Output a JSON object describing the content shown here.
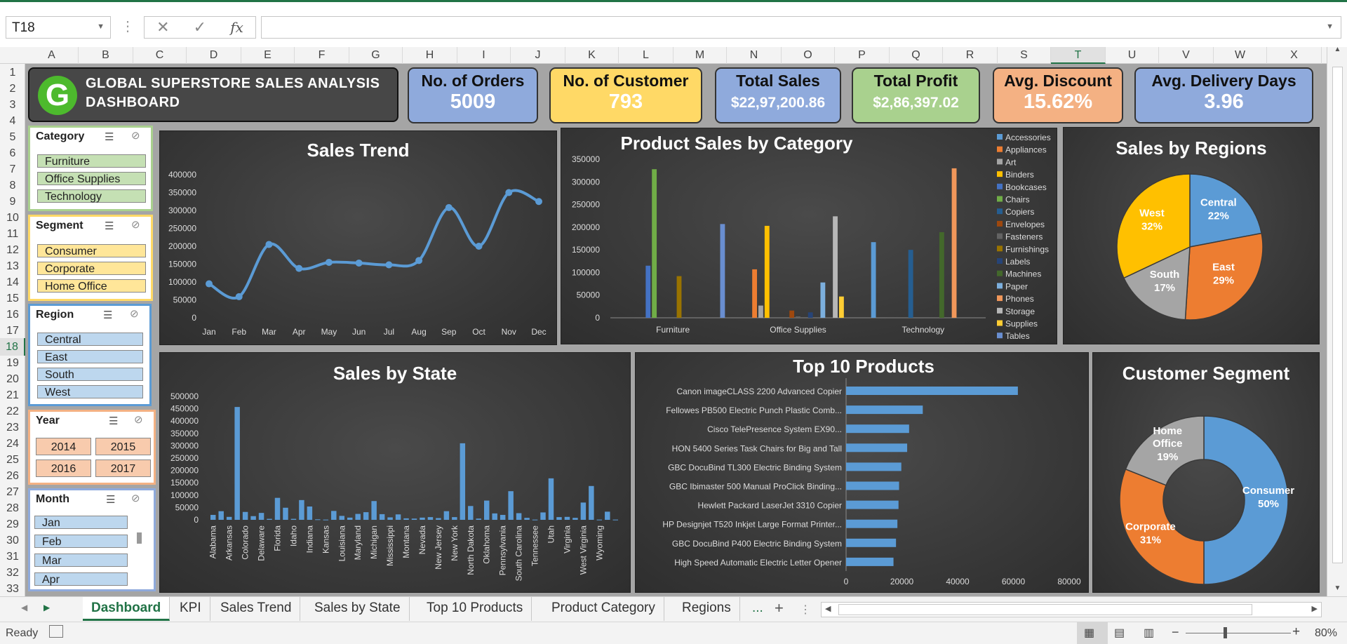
{
  "formula_bar": {
    "name_box": "T18",
    "fx_label": "fx",
    "formula": ""
  },
  "columns": [
    "A",
    "B",
    "C",
    "D",
    "E",
    "F",
    "G",
    "H",
    "I",
    "J",
    "K",
    "L",
    "M",
    "N",
    "O",
    "P",
    "Q",
    "R",
    "S",
    "T",
    "U",
    "V",
    "W",
    "X"
  ],
  "selected_column": "T",
  "rows": [
    "1",
    "2",
    "3",
    "4",
    "5",
    "6",
    "7",
    "8",
    "9",
    "10",
    "11",
    "12",
    "13",
    "14",
    "15",
    "16",
    "17",
    "18",
    "19",
    "20",
    "21",
    "22",
    "23",
    "24",
    "25",
    "26",
    "27",
    "28",
    "29",
    "30",
    "31",
    "32",
    "33"
  ],
  "selected_row": "18",
  "title": {
    "line1": "GLOBAL SUPERSTORE SALES ANALYSIS",
    "line2": "DASHBOARD",
    "logo_letter": "G"
  },
  "kpis": [
    {
      "label": "No. of Orders",
      "value": "5009",
      "bg": "#8faadc"
    },
    {
      "label": "No. of Customer",
      "value": "793",
      "bg": "#ffd966"
    },
    {
      "label": "Total Sales",
      "value": "$22,97,200.86",
      "bg": "#8faadc"
    },
    {
      "label": "Total Profit",
      "value": "$2,86,397.02",
      "bg": "#a9d18e"
    },
    {
      "label": "Avg. Discount",
      "value": "15.62%",
      "bg": "#f4b183"
    },
    {
      "label": "Avg. Delivery Days",
      "value": "3.96",
      "bg": "#8faadc"
    }
  ],
  "slicers": {
    "category": {
      "title": "Category",
      "items": [
        "Furniture",
        "Office Supplies",
        "Technology"
      ],
      "color": "#c5e0b4",
      "border": "#a9d18e"
    },
    "segment": {
      "title": "Segment",
      "items": [
        "Consumer",
        "Corporate",
        "Home Office"
      ],
      "color": "#ffe699",
      "border": "#ffd966"
    },
    "region": {
      "title": "Region",
      "items": [
        "Central",
        "East",
        "South",
        "West"
      ],
      "color": "#bdd7ee",
      "border": "#5b9bd5"
    },
    "year": {
      "title": "Year",
      "items": [
        "2014",
        "2015",
        "2016",
        "2017"
      ],
      "color": "#f8cbad",
      "border": "#f4b183"
    },
    "month": {
      "title": "Month",
      "items": [
        "Jan",
        "Feb",
        "Mar",
        "Apr"
      ],
      "color": "#bdd7ee",
      "border": "#8faadc"
    }
  },
  "chart_data": [
    {
      "type": "line",
      "title": "Sales Trend",
      "categories": [
        "Jan",
        "Feb",
        "Mar",
        "Apr",
        "May",
        "Jun",
        "Jul",
        "Aug",
        "Sep",
        "Oct",
        "Nov",
        "Dec"
      ],
      "values": [
        95000,
        59000,
        205000,
        138000,
        155000,
        153000,
        148000,
        160000,
        308000,
        200000,
        350000,
        325000
      ],
      "ylim": [
        0,
        400000
      ],
      "yticks": [
        "400000",
        "350000",
        "300000",
        "250000",
        "200000",
        "150000",
        "100000",
        "50000",
        "0"
      ],
      "color": "#5b9bd5"
    },
    {
      "type": "bar",
      "title": "Product Sales by Category",
      "categories": [
        "Furniture",
        "Office Supplies",
        "Technology"
      ],
      "ylim": [
        0,
        350000
      ],
      "yticks": [
        "350000",
        "300000",
        "250000",
        "200000",
        "150000",
        "100000",
        "50000",
        "0"
      ],
      "legend_position": "right",
      "series": [
        {
          "name": "Accessories",
          "color": "#5b9bd5",
          "values": [
            0,
            0,
            167000
          ]
        },
        {
          "name": "Appliances",
          "color": "#ed7d31",
          "values": [
            0,
            107000,
            0
          ]
        },
        {
          "name": "Art",
          "color": "#a5a5a5",
          "values": [
            0,
            27000,
            0
          ]
        },
        {
          "name": "Binders",
          "color": "#ffc000",
          "values": [
            0,
            203000,
            0
          ]
        },
        {
          "name": "Bookcases",
          "color": "#4472c4",
          "values": [
            115000,
            0,
            0
          ]
        },
        {
          "name": "Chairs",
          "color": "#70ad47",
          "values": [
            328000,
            0,
            0
          ]
        },
        {
          "name": "Copiers",
          "color": "#255e91",
          "values": [
            0,
            0,
            150000
          ]
        },
        {
          "name": "Envelopes",
          "color": "#9e480e",
          "values": [
            0,
            16000,
            0
          ]
        },
        {
          "name": "Fasteners",
          "color": "#636363",
          "values": [
            0,
            3000,
            0
          ]
        },
        {
          "name": "Furnishings",
          "color": "#997300",
          "values": [
            92000,
            0,
            0
          ]
        },
        {
          "name": "Labels",
          "color": "#264478",
          "values": [
            0,
            12000,
            0
          ]
        },
        {
          "name": "Machines",
          "color": "#43682b",
          "values": [
            0,
            0,
            189000
          ]
        },
        {
          "name": "Paper",
          "color": "#7cafdd",
          "values": [
            0,
            78000,
            0
          ]
        },
        {
          "name": "Phones",
          "color": "#f1975a",
          "values": [
            0,
            0,
            330000
          ]
        },
        {
          "name": "Storage",
          "color": "#b7b7b7",
          "values": [
            0,
            224000,
            0
          ]
        },
        {
          "name": "Supplies",
          "color": "#ffcd33",
          "values": [
            0,
            47000,
            0
          ]
        },
        {
          "name": "Tables",
          "color": "#698ed0",
          "values": [
            207000,
            0,
            0
          ]
        }
      ]
    },
    {
      "type": "pie",
      "title": "Sales by Regions",
      "slices": [
        {
          "label": "Central",
          "pct": "22%",
          "value": 22,
          "color": "#5b9bd5"
        },
        {
          "label": "East",
          "pct": "29%",
          "value": 29,
          "color": "#ed7d31"
        },
        {
          "label": "South",
          "pct": "17%",
          "value": 17,
          "color": "#a5a5a5"
        },
        {
          "label": "West",
          "pct": "32%",
          "value": 32,
          "color": "#ffc000"
        }
      ]
    },
    {
      "type": "bar",
      "title": "Sales by State",
      "ylim": [
        0,
        500000
      ],
      "yticks": [
        "500000",
        "450000",
        "400000",
        "350000",
        "300000",
        "250000",
        "200000",
        "150000",
        "100000",
        "50000",
        "0"
      ],
      "tick_labels": [
        "Alabama",
        "Arkansas",
        "Colorado",
        "Delaware",
        "Florida",
        "Idaho",
        "Indiana",
        "Kansas",
        "Louisiana",
        "Maryland",
        "Michigan",
        "Mississippi",
        "Montana",
        "Nevada",
        "New Jersey",
        "New York",
        "North Dakota",
        "Oklahoma",
        "Pennsylvania",
        "South Carolina",
        "Tennessee",
        "Utah",
        "Virginia",
        "West Virginia",
        "Wyoming"
      ],
      "values": [
        20000,
        35000,
        12000,
        457000,
        32000,
        15000,
        28000,
        4000,
        89000,
        49000,
        4000,
        80000,
        54000,
        2000,
        1000,
        36000,
        16000,
        9000,
        24000,
        31000,
        76000,
        23000,
        10000,
        22000,
        6000,
        5000,
        9000,
        11000,
        7000,
        35000,
        11000,
        310000,
        56000,
        5000,
        78000,
        26000,
        20000,
        116000,
        27000,
        8000,
        1000,
        30000,
        168000,
        11000,
        12000,
        8000,
        70000,
        137000,
        1000,
        33000,
        1000
      ],
      "color": "#5b9bd5"
    },
    {
      "type": "bar",
      "title": "Top 10 Products",
      "orientation": "horizontal",
      "categories": [
        "Canon imageCLASS 2200 Advanced Copier",
        "Fellowes PB500 Electric Punch Plastic Comb...",
        "Cisco TelePresence System EX90...",
        "HON 5400 Series Task Chairs for Big and Tall",
        "GBC DocuBind TL300 Electric Binding System",
        "GBC Ibimaster 500 Manual ProClick Binding...",
        "Hewlett Packard LaserJet 3310 Copier",
        "HP Designjet T520 Inkjet Large Format Printer...",
        "GBC DocuBind P400 Electric Binding System",
        "High Speed Automatic Electric Letter Opener"
      ],
      "values": [
        61600,
        27500,
        22600,
        21900,
        19800,
        19000,
        18800,
        18400,
        17900,
        17000
      ],
      "xlim": [
        0,
        80000
      ],
      "xticks": [
        "0",
        "20000",
        "40000",
        "60000",
        "80000"
      ],
      "color": "#5b9bd5"
    },
    {
      "type": "pie",
      "title": "Customer Segment",
      "donut": true,
      "slices": [
        {
          "label": "Consumer",
          "pct": "50%",
          "value": 50,
          "color": "#5b9bd5"
        },
        {
          "label": "Corporate",
          "pct": "31%",
          "value": 31,
          "color": "#ed7d31"
        },
        {
          "label": "Home Office",
          "pct": "19%",
          "value": 19,
          "color": "#a5a5a5"
        }
      ]
    }
  ],
  "sheet_tabs": {
    "items": [
      "Dashboard",
      "KPI",
      "Sales Trend",
      "Sales by State",
      "Top 10 Products",
      "Product Category",
      "Regions"
    ],
    "active": "Dashboard",
    "more": "...",
    "add": "+"
  },
  "status": {
    "ready": "Ready",
    "zoom": "80%",
    "minus": "−",
    "plus": "+"
  },
  "colors": {
    "excel_green": "#217346",
    "panel_dark": "#3a3a3a",
    "canvas_gray": "#a5a5a5"
  }
}
